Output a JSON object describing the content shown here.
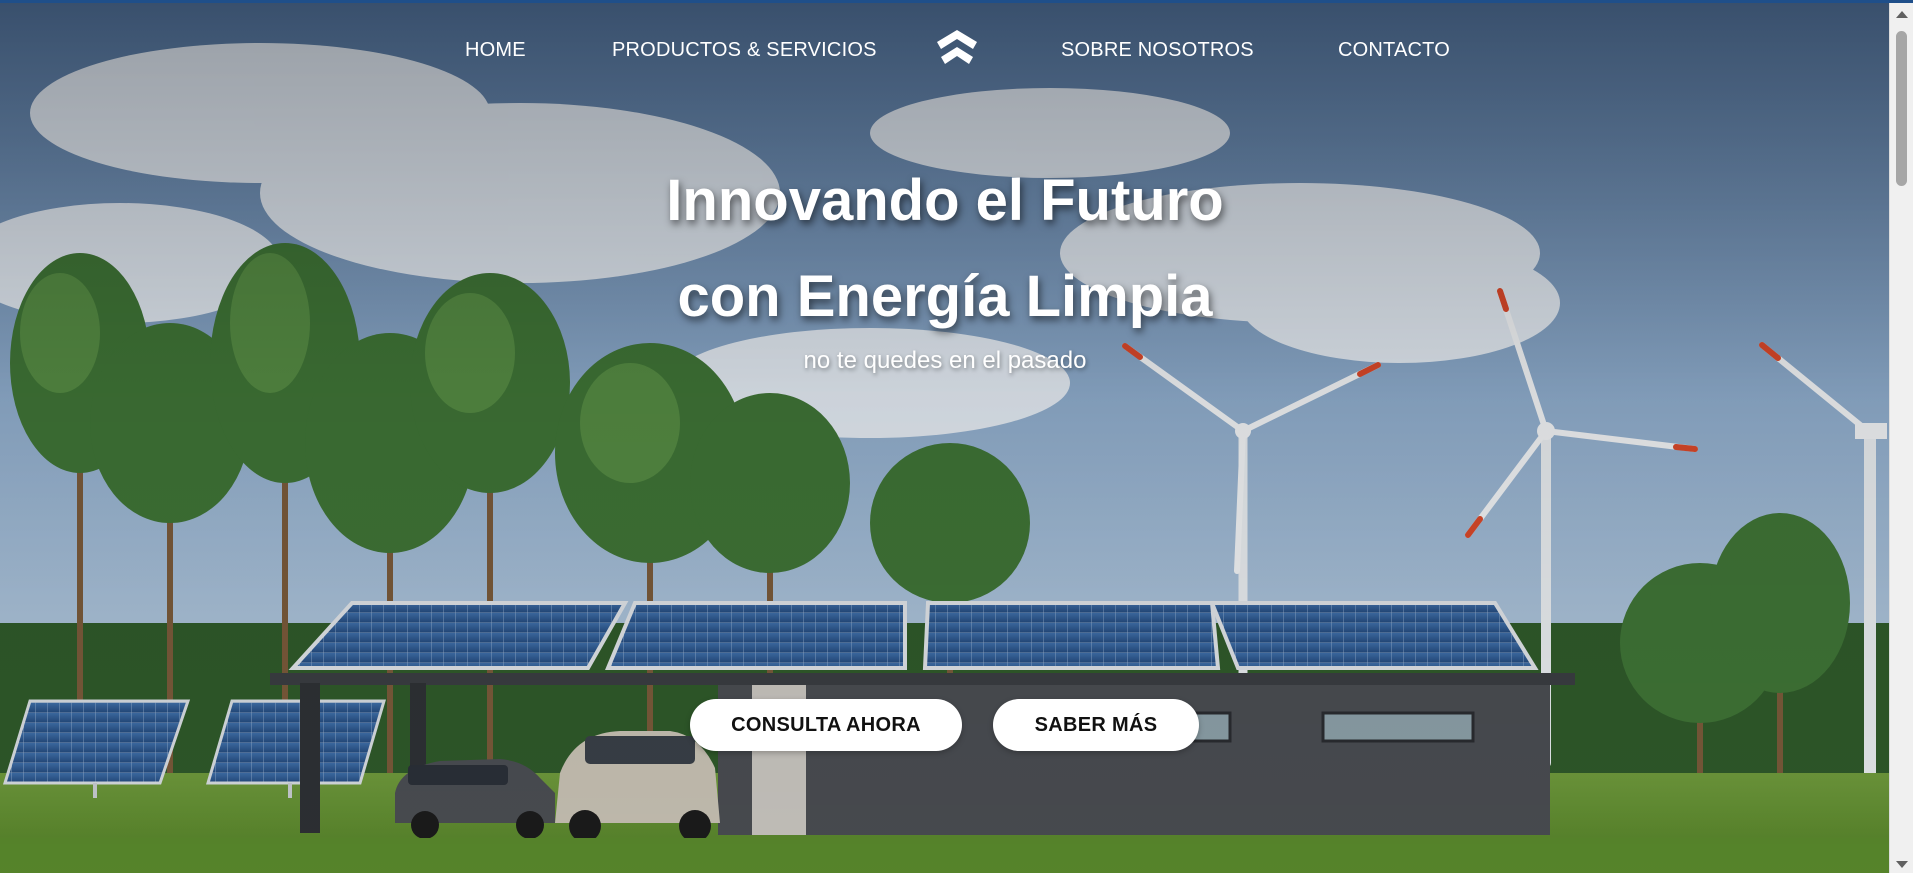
{
  "nav": {
    "items": [
      {
        "label": "HOME"
      },
      {
        "label": "PRODUCTOS & SERVICIOS"
      },
      {
        "label": "SOBRE NOSOTROS"
      },
      {
        "label": "CONTACTO"
      }
    ],
    "logo_icon": "brand-logo-icon"
  },
  "hero": {
    "title_line1": "Innovando el Futuro",
    "title_line2": "con Energía Limpia",
    "subtitle": "no te quedes en el pasado",
    "background": "solar-panels-and-wind-turbines-photo"
  },
  "buttons": {
    "consult_label": "CONSULTA AHORA",
    "learn_label": "SABER MÁS"
  },
  "colors": {
    "accent_border": "#1f4f8a",
    "button_bg": "#ffffff",
    "text_on_photo": "#ffffff"
  }
}
